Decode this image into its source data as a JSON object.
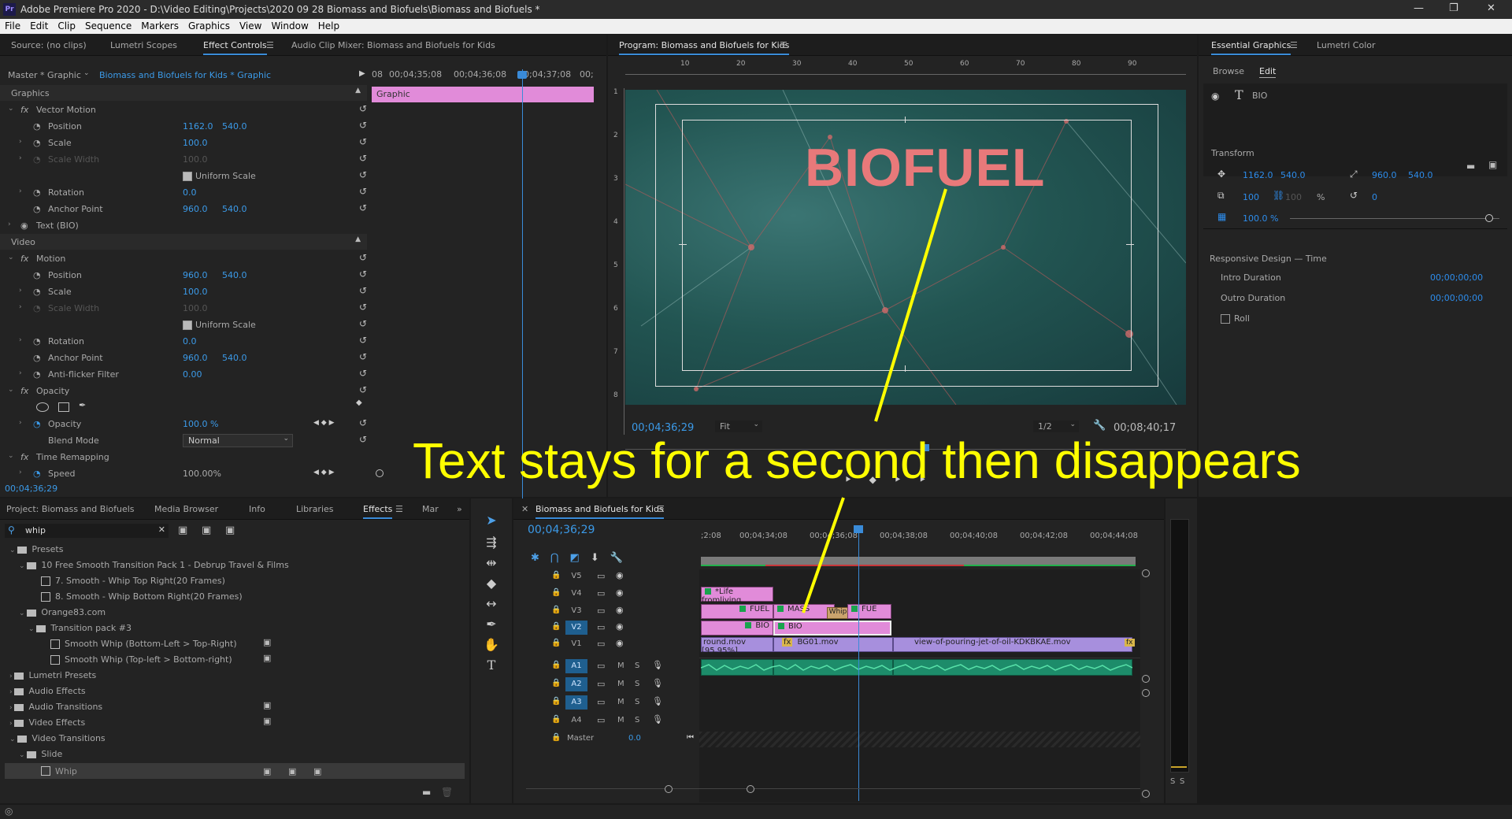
{
  "titlebar": {
    "title": "Adobe Premiere Pro 2020 - D:\\Video Editing\\Projects\\2020 09 28 Biomass and Biofuels\\Biomass and Biofuels *",
    "app_icon": "Pr",
    "min": "—",
    "max": "❐",
    "close": "✕"
  },
  "menu": [
    "File",
    "Edit",
    "Clip",
    "Sequence",
    "Markers",
    "Graphics",
    "View",
    "Window",
    "Help"
  ],
  "source_tabs": {
    "source": "Source: (no clips)",
    "lumetri": "Lumetri Scopes",
    "effect_controls": "Effect Controls",
    "audio_mixer": "Audio Clip Mixer: Biomass and Biofuels for Kids"
  },
  "ec": {
    "master": "Master * Graphic",
    "seq": "Biomass and Biofuels for Kids * Graphic",
    "ruler": [
      "08",
      "00;04;35;08",
      "00;04;36;08",
      "00;04;37;08",
      "00;"
    ],
    "graphic_clip": "Graphic",
    "sec_graphics": "Graphics",
    "vector_motion": "Vector Motion",
    "vm_pos_label": "Position",
    "vm_pos_x": "1162.0",
    "vm_pos_y": "540.0",
    "vm_scale_label": "Scale",
    "vm_scale": "100.0",
    "vm_sw_label": "Scale Width",
    "vm_sw": "100.0",
    "vm_uniform": "Uniform Scale",
    "vm_rot_label": "Rotation",
    "vm_rot": "0.0",
    "vm_anchor_label": "Anchor Point",
    "vm_anchor_x": "960.0",
    "vm_anchor_y": "540.0",
    "text_layer": "Text (BIO)",
    "sec_video": "Video",
    "motion": "Motion",
    "m_pos_label": "Position",
    "m_pos_x": "960.0",
    "m_pos_y": "540.0",
    "m_scale_label": "Scale",
    "m_scale": "100.0",
    "m_sw_label": "Scale Width",
    "m_sw": "100.0",
    "m_uniform": "Uniform Scale",
    "m_rot_label": "Rotation",
    "m_rot": "0.0",
    "m_anchor_label": "Anchor Point",
    "m_anchor_x": "960.0",
    "m_anchor_y": "540.0",
    "m_af_label": "Anti-flicker Filter",
    "m_af": "0.00",
    "opacity": "Opacity",
    "op_label": "Opacity",
    "op_val": "100.0 %",
    "blend_label": "Blend Mode",
    "blend_val": "Normal",
    "time_remap": "Time Remapping",
    "speed_label": "Speed",
    "speed_val": "100.00%",
    "timecode": "00;04;36;29"
  },
  "program": {
    "title": "Program: Biomass and Biofuels for Kids",
    "ruler": [
      "10",
      "20",
      "30",
      "40",
      "50",
      "60",
      "70",
      "80",
      "90"
    ],
    "vruler": [
      "1",
      "2",
      "3",
      "4",
      "5",
      "6",
      "7",
      "8"
    ],
    "headline": "BIOFUEL",
    "timecode": "00;04;36;29",
    "fit": "Fit",
    "res": "1/2",
    "duration": "00;08;40;17"
  },
  "essential": {
    "tab1": "Essential Graphics",
    "tab2": "Lumetri Color",
    "browse": "Browse",
    "edit": "Edit",
    "layer": "BIO",
    "transform": "Transform",
    "pos_x": "1162.0",
    "pos_y": "540.0",
    "anchor_x": "960.0",
    "anchor_y": "540.0",
    "scale": "100",
    "scale2": "100",
    "pct": "%",
    "rotation": "0",
    "opacity": "100.0 %",
    "responsive": "Responsive Design — Time",
    "intro": "Intro Duration",
    "intro_val": "00;00;00;00",
    "outro": "Outro Duration",
    "outro_val": "00;00;00;00",
    "roll": "Roll"
  },
  "project_tabs": {
    "project": "Project: Biomass and Biofuels",
    "media": "Media Browser",
    "info": "Info",
    "libraries": "Libraries",
    "effects": "Effects",
    "markers": "Mar"
  },
  "search": {
    "value": "whip"
  },
  "tree": [
    "Presets",
    "10 Free Smooth Transition Pack 1 - Debrup Travel & Films",
    "7. Smooth - Whip Top Right(20 Frames)",
    "8. Smooth - Whip Bottom Right(20 Frames)",
    "Orange83.com",
    "Transition pack #3",
    "Smooth Whip (Bottom-Left > Top-Right)",
    "Smooth Whip (Top-left > Bottom-right)",
    "Lumetri Presets",
    "Audio Effects",
    "Audio Transitions",
    "Video Effects",
    "Video Transitions",
    "Slide",
    "Whip"
  ],
  "timeline": {
    "title": "Biomass and Biofuels for Kids",
    "timecode": "00;04;36;29",
    "ruler": [
      ";2:08",
      "00;04;34;08",
      "00;04;36;08",
      "00;04;38;08",
      "00;04;40;08",
      "00;04;42;08",
      "00;04;44;08"
    ],
    "tracks": [
      "V5",
      "V4",
      "V3",
      "V2",
      "V1",
      "A1",
      "A2",
      "A3",
      "A4"
    ],
    "master": "Master",
    "master_val": "0.0",
    "m": "M",
    "s": "S",
    "clips": {
      "life": "*Life fromliving",
      "fuel": "FUEL",
      "mass": "MASS",
      "whip": "Whip",
      "fue": "FUE",
      "bio1": "BIO",
      "bio2": "BIO",
      "round": "round.mov [95.95%]",
      "bg01": "BG01.mov",
      "pour": "view-of-pouring-jet-of-oil-KDKBKAE.mov",
      "fx": "fx"
    }
  },
  "meter": {
    "s1": "S",
    "s2": "S"
  },
  "annotation": {
    "text": "Text stays for a second then disappears"
  }
}
